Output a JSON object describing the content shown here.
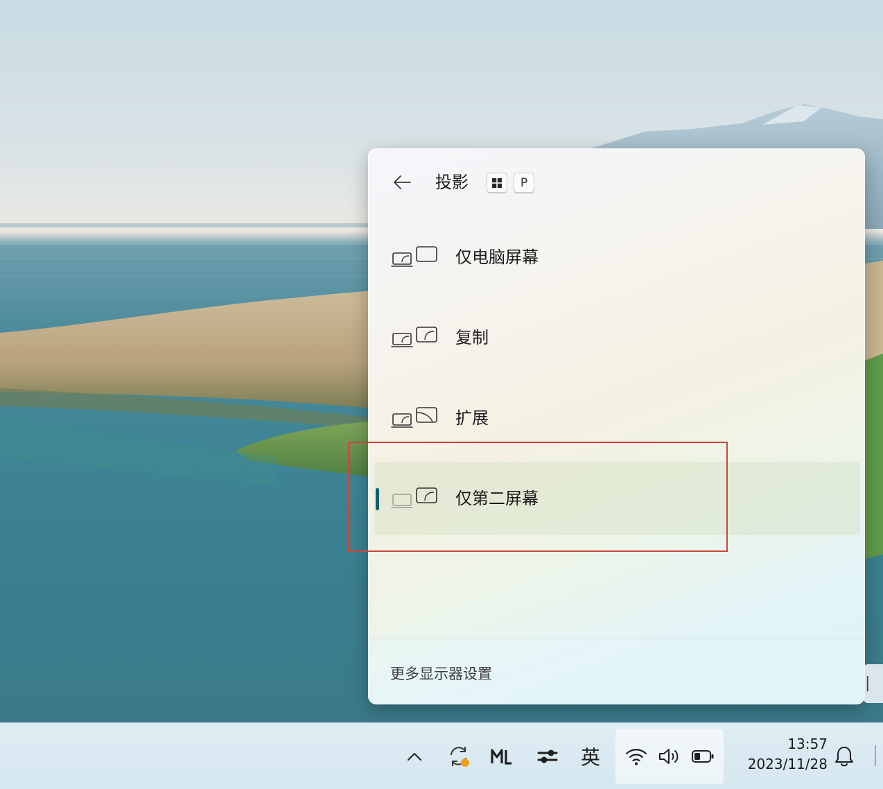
{
  "flyout": {
    "title": "投影",
    "shortcut_keys": [
      "windows-key-icon",
      "P"
    ],
    "options": [
      {
        "label": "仅电脑屏幕",
        "icon": "pc-screen-only-icon",
        "selected": false
      },
      {
        "label": "复制",
        "icon": "duplicate-icon",
        "selected": false
      },
      {
        "label": "扩展",
        "icon": "extend-icon",
        "selected": false
      },
      {
        "label": "仅第二屏幕",
        "icon": "second-screen-only-icon",
        "selected": true
      }
    ],
    "more_settings": "更多显示器设置"
  },
  "taskbar": {
    "ime_label": "英",
    "time": "13:57",
    "date": "2023/11/28",
    "tray_icons": [
      "chevron-up-icon",
      "sync-icon",
      "meeting-app-icon",
      "settings-toggle-icon",
      "wifi-icon",
      "volume-icon",
      "battery-icon",
      "bell-icon"
    ]
  },
  "colors": {
    "accent": "#0f5f6e",
    "highlight_box": "#c8473b"
  }
}
